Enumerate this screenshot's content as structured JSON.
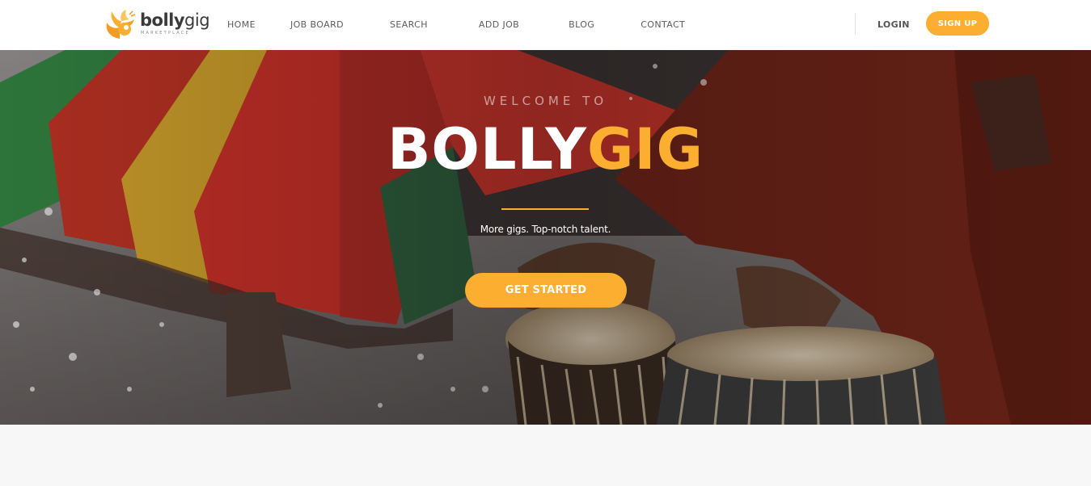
{
  "brand": {
    "name_bold": "bolly",
    "name_light": "gig",
    "tagline": "MARKETPLACE",
    "accent_color": "#fbae30"
  },
  "nav": {
    "items": [
      {
        "label": "HOME"
      },
      {
        "label": "JOB BOARD"
      },
      {
        "label": "SEARCH"
      },
      {
        "label": "ADD JOB"
      },
      {
        "label": "BLOG"
      },
      {
        "label": "CONTACT"
      }
    ],
    "login_label": "LOGIN",
    "signup_label": "SIGN UP"
  },
  "hero": {
    "welcome": "WELCOME TO",
    "title_white": "BOLLY",
    "title_accent": "GIG",
    "tagline": "More gigs. Top-notch talent.",
    "cta_label": "GET STARTED",
    "background": "photo: dancer in colorful skirt and musician playing tabla drums"
  }
}
